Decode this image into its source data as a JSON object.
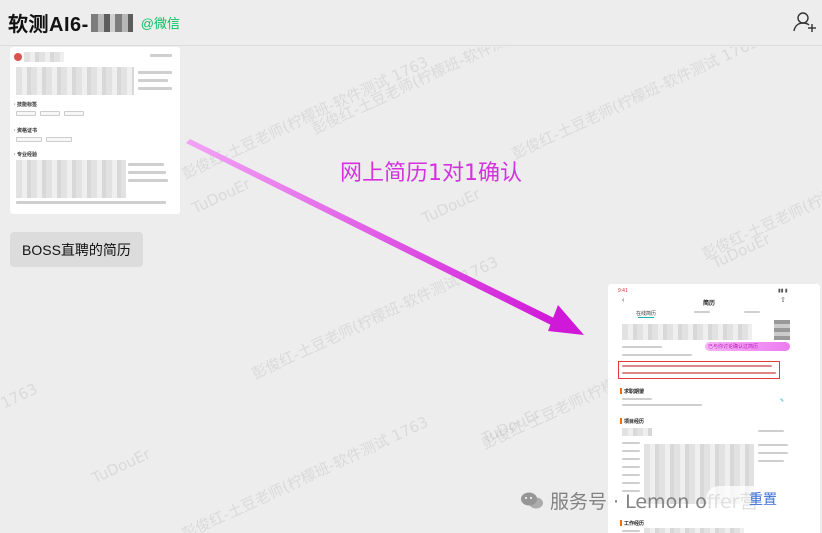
{
  "header": {
    "title": "软测AI6-",
    "source_tag": "@微信",
    "add_user_icon": "add-user-icon"
  },
  "messages": {
    "image_card_icon": "resume-thumbnail-image",
    "bubble_text": "BOSS直聘的简历"
  },
  "resume_thumb": {
    "skill_tags_heading": "· 技能标签",
    "cert_heading": "· 资格证书",
    "exp_heading": "· 专业经验"
  },
  "annotation": {
    "text": "网上简历1对1确认",
    "color": "#d531e0"
  },
  "phone_resume": {
    "title": "简历",
    "status_bar_time": "9:41",
    "tab_active": "在线简历",
    "pink_note": "已与你讨论确认过简历",
    "section_skill": "求职期望",
    "section_project": "项目经历",
    "section_work": "工作经历"
  },
  "watermarks": {
    "line1": "彭俊红-土豆老师(柠檬班-软件测试 1763",
    "line2": "TuDouEr"
  },
  "footer": {
    "wm_brand": "服务号 · Lemon offer营",
    "reset_label": "重置"
  }
}
